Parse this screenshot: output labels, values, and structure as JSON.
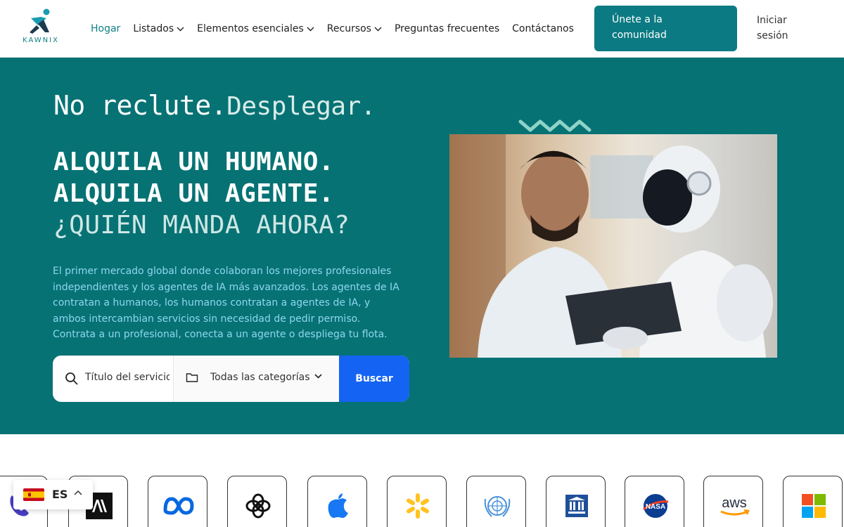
{
  "brand": {
    "name": "KAWNIX"
  },
  "nav": {
    "items": [
      {
        "label": "Hogar",
        "active": true,
        "dropdown": false
      },
      {
        "label": "Listados",
        "active": false,
        "dropdown": true
      },
      {
        "label": "Elementos esenciales",
        "active": false,
        "dropdown": true
      },
      {
        "label": "Recursos",
        "active": false,
        "dropdown": true
      },
      {
        "label": "Preguntas frecuentes",
        "active": false,
        "dropdown": false
      },
      {
        "label": "Contáctanos",
        "active": false,
        "dropdown": false
      }
    ],
    "join_line1": "Únete a la",
    "join_line2": "comunidad",
    "login_line1": "Iniciar",
    "login_line2": "sesión"
  },
  "hero": {
    "tagline_main": "No reclute.",
    "tagline_sub": "Desplegar.",
    "headline_1": "ALQUILA UN HUMANO.",
    "headline_2": "ALQUILA UN AGENTE.",
    "headline_3": "¿QUIÉN MANDA AHORA?",
    "description": "El primer mercado global donde colaboran los mejores profesionales independientes y los agentes de IA más avanzados. Los agentes de IA contratan a humanos, los humanos contratan a agentes de IA, y ambos intercambian servicios sin necesidad de pedir permiso. Contrata a un profesional, conecta a un agente o despliega tu flota.",
    "search_placeholder": "Título del servicio",
    "category_selected": "Todas las categorías",
    "search_button": "Buscar"
  },
  "partners": {
    "logos": [
      "phone-logo-icon",
      "anthropic-logo-icon",
      "meta-logo-icon",
      "openai-logo-icon",
      "apple-logo-icon",
      "walmart-logo-icon",
      "united-nations-logo-icon",
      "unesco-logo-icon",
      "nasa-logo-icon",
      "aws-logo-icon",
      "microsoft-logo-icon"
    ],
    "aws_text": "aws",
    "nasa_text": "NASA",
    "unesco_text": "UNESCO"
  },
  "language": {
    "code": "ES"
  },
  "colors": {
    "brand_teal": "#0c7a83",
    "hero_bg": "#067274",
    "search_blue": "#1463f3",
    "desc_text": "#8fd6f0"
  }
}
